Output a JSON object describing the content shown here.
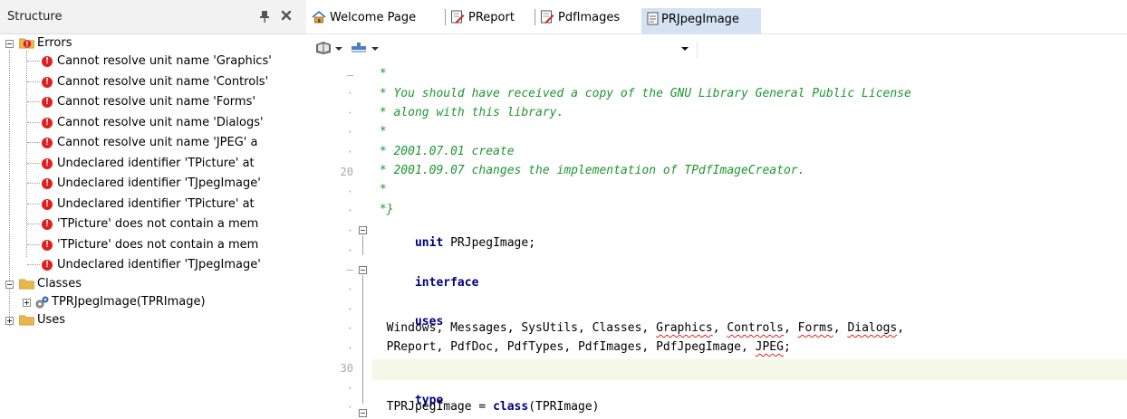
{
  "structure": {
    "title": "Structure",
    "errors_label": "Errors",
    "errors": [
      "Cannot resolve unit name 'Graphics'",
      "Cannot resolve unit name 'Controls'",
      "Cannot resolve unit name 'Forms'",
      "Cannot resolve unit name 'Dialogs'",
      "Cannot resolve unit name 'JPEG' a",
      "Undeclared identifier 'TPicture' at",
      "Undeclared identifier 'TJpegImage'",
      "Undeclared identifier 'TPicture' at",
      "'TPicture' does not contain a mem",
      "'TPicture' does not contain a mem",
      "Undeclared identifier 'TJpegImage'"
    ],
    "classes_label": "Classes",
    "class_item": "TPRJpegImage(TPRImage)",
    "uses_label": "Uses"
  },
  "tabs": [
    {
      "label": "Welcome Page",
      "icon": "home-icon"
    },
    {
      "label": "PReport",
      "icon": "unit-icon"
    },
    {
      "label": "PdfImages",
      "icon": "unit-icon"
    },
    {
      "label": "PRJpegImage",
      "icon": "document-icon",
      "active": true
    }
  ],
  "gutter_numbers": {
    "line_20": "20",
    "line_30": "30"
  },
  "code": {
    "l1": " *",
    "l2": " * You should have received a copy of the GNU Library General Public License",
    "l3": " * along with this library.",
    "l4": " *",
    "l5": " * 2001.07.01 create",
    "l6": " * 2001.09.07 changes the implementation of TPdfImageCreator.",
    "l7": " *",
    "l8": " *}",
    "l9_kw": "unit",
    "l9_rest": " PRJpegImage;",
    "l11_kw": "interface",
    "l13_kw": "uses",
    "l14a": "  Windows, Messages, SysUtils, Classes, ",
    "l14_g": "Graphics",
    "l14_c1": ", ",
    "l14_ctl": "Controls",
    "l14_c2": ", ",
    "l14_f": "Forms",
    "l14_c3": ", ",
    "l14_d": "Dialogs",
    "l14_end": ",",
    "l15a": "  PReport, PdfDoc, PdfTypes, PdfImages, PdfJpegImage, ",
    "l15_j": "JPEG",
    "l15_end": ";",
    "l17_kw": "type",
    "l18a": "  TPRJpegImage = ",
    "l18_kw": "class",
    "l18_rest": "(TPRImage)"
  },
  "colors": {
    "comment": "#1f9631",
    "keyword": "#000080",
    "error": "#e0201e",
    "active_tab": "#d4e2f4"
  }
}
